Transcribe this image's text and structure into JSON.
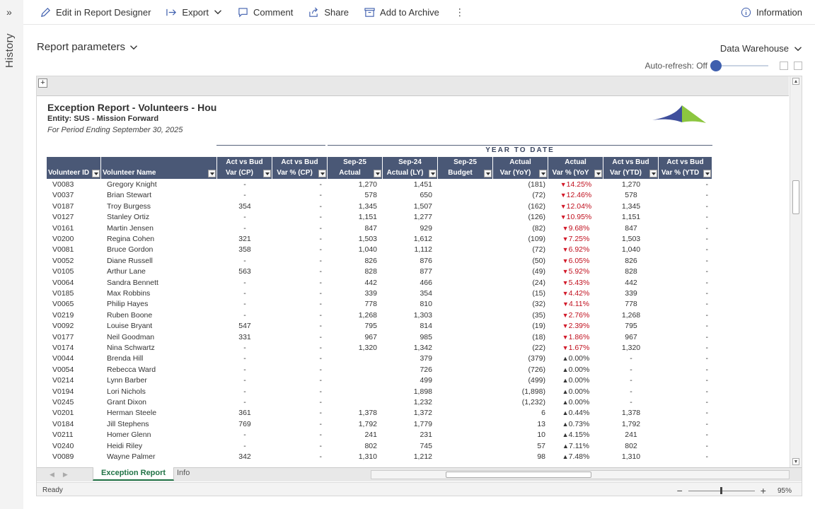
{
  "rail": {
    "chevron": "»",
    "label": "History"
  },
  "toolbar": {
    "edit": "Edit in Report Designer",
    "export": "Export",
    "comment": "Comment",
    "share": "Share",
    "archive": "Add to Archive",
    "more": "⋮",
    "info": "Information"
  },
  "params": {
    "label": "Report parameters"
  },
  "source": {
    "label": "Data Warehouse"
  },
  "refresh": {
    "label": "Auto-refresh: Off"
  },
  "report": {
    "title": "Exception Report - Volunteers - Hou",
    "entity": "Entity: SUS - Mission Forward",
    "period": "For Period Ending September 30, 2025",
    "ytd": "YEAR TO DATE",
    "brand_colors": {
      "blue": "#3f4f9c",
      "green": "#8cc63f"
    }
  },
  "headers": [
    {
      "l1": "",
      "l2": "Volunteer ID"
    },
    {
      "l1": "",
      "l2": "Volunteer Name"
    },
    {
      "l1": "Act vs Bud",
      "l2": "Var (CP)"
    },
    {
      "l1": "Act vs Bud",
      "l2": "Var % (CP)"
    },
    {
      "l1": "Sep-25",
      "l2": "Actual"
    },
    {
      "l1": "Sep-24",
      "l2": "Actual (LY)"
    },
    {
      "l1": "Sep-25",
      "l2": "Budget"
    },
    {
      "l1": "Actual",
      "l2": "Var (YoY)"
    },
    {
      "l1": "Actual",
      "l2": "Var % (YoY"
    },
    {
      "l1": "Act vs Bud",
      "l2": "Var (YTD)"
    },
    {
      "l1": "Act vs Bud",
      "l2": "Var % (YTD"
    }
  ],
  "rows": [
    {
      "id": "V0083",
      "name": "Gregory Knight",
      "var_cp": "-",
      "varp_cp": "-",
      "act": "1,270",
      "ly": "1,451",
      "bud": "",
      "var_yoy": "(181)",
      "dir": "down",
      "pct": "14.25%",
      "var_ytd": "1,270",
      "varp_ytd": "-"
    },
    {
      "id": "V0037",
      "name": "Brian Stewart",
      "var_cp": "-",
      "varp_cp": "-",
      "act": "578",
      "ly": "650",
      "bud": "",
      "var_yoy": "(72)",
      "dir": "down",
      "pct": "12.46%",
      "var_ytd": "578",
      "varp_ytd": "-"
    },
    {
      "id": "V0187",
      "name": "Troy Burgess",
      "var_cp": "354",
      "varp_cp": "-",
      "act": "1,345",
      "ly": "1,507",
      "bud": "",
      "var_yoy": "(162)",
      "dir": "down",
      "pct": "12.04%",
      "var_ytd": "1,345",
      "varp_ytd": "-"
    },
    {
      "id": "V0127",
      "name": "Stanley Ortiz",
      "var_cp": "-",
      "varp_cp": "-",
      "act": "1,151",
      "ly": "1,277",
      "bud": "",
      "var_yoy": "(126)",
      "dir": "down",
      "pct": "10.95%",
      "var_ytd": "1,151",
      "varp_ytd": "-"
    },
    {
      "id": "V0161",
      "name": "Martin Jensen",
      "var_cp": "-",
      "varp_cp": "-",
      "act": "847",
      "ly": "929",
      "bud": "",
      "var_yoy": "(82)",
      "dir": "down",
      "pct": "9.68%",
      "var_ytd": "847",
      "varp_ytd": "-"
    },
    {
      "id": "V0200",
      "name": "Regina Cohen",
      "var_cp": "321",
      "varp_cp": "-",
      "act": "1,503",
      "ly": "1,612",
      "bud": "",
      "var_yoy": "(109)",
      "dir": "down",
      "pct": "7.25%",
      "var_ytd": "1,503",
      "varp_ytd": "-"
    },
    {
      "id": "V0081",
      "name": "Bruce Gordon",
      "var_cp": "358",
      "varp_cp": "-",
      "act": "1,040",
      "ly": "1,112",
      "bud": "",
      "var_yoy": "(72)",
      "dir": "down",
      "pct": "6.92%",
      "var_ytd": "1,040",
      "varp_ytd": "-"
    },
    {
      "id": "V0052",
      "name": "Diane Russell",
      "var_cp": "-",
      "varp_cp": "-",
      "act": "826",
      "ly": "876",
      "bud": "",
      "var_yoy": "(50)",
      "dir": "down",
      "pct": "6.05%",
      "var_ytd": "826",
      "varp_ytd": "-"
    },
    {
      "id": "V0105",
      "name": "Arthur Lane",
      "var_cp": "563",
      "varp_cp": "-",
      "act": "828",
      "ly": "877",
      "bud": "",
      "var_yoy": "(49)",
      "dir": "down",
      "pct": "5.92%",
      "var_ytd": "828",
      "varp_ytd": "-"
    },
    {
      "id": "V0064",
      "name": "Sandra Bennett",
      "var_cp": "-",
      "varp_cp": "-",
      "act": "442",
      "ly": "466",
      "bud": "",
      "var_yoy": "(24)",
      "dir": "down",
      "pct": "5.43%",
      "var_ytd": "442",
      "varp_ytd": "-"
    },
    {
      "id": "V0185",
      "name": "Max Robbins",
      "var_cp": "-",
      "varp_cp": "-",
      "act": "339",
      "ly": "354",
      "bud": "",
      "var_yoy": "(15)",
      "dir": "down",
      "pct": "4.42%",
      "var_ytd": "339",
      "varp_ytd": "-"
    },
    {
      "id": "V0065",
      "name": "Philip Hayes",
      "var_cp": "-",
      "varp_cp": "-",
      "act": "778",
      "ly": "810",
      "bud": "",
      "var_yoy": "(32)",
      "dir": "down",
      "pct": "4.11%",
      "var_ytd": "778",
      "varp_ytd": "-"
    },
    {
      "id": "V0219",
      "name": "Ruben Boone",
      "var_cp": "-",
      "varp_cp": "-",
      "act": "1,268",
      "ly": "1,303",
      "bud": "",
      "var_yoy": "(35)",
      "dir": "down",
      "pct": "2.76%",
      "var_ytd": "1,268",
      "varp_ytd": "-"
    },
    {
      "id": "V0092",
      "name": "Louise Bryant",
      "var_cp": "547",
      "varp_cp": "-",
      "act": "795",
      "ly": "814",
      "bud": "",
      "var_yoy": "(19)",
      "dir": "down",
      "pct": "2.39%",
      "var_ytd": "795",
      "varp_ytd": "-"
    },
    {
      "id": "V0177",
      "name": "Neil Goodman",
      "var_cp": "331",
      "varp_cp": "-",
      "act": "967",
      "ly": "985",
      "bud": "",
      "var_yoy": "(18)",
      "dir": "down",
      "pct": "1.86%",
      "var_ytd": "967",
      "varp_ytd": "-"
    },
    {
      "id": "V0174",
      "name": "Nina Schwartz",
      "var_cp": "-",
      "varp_cp": "-",
      "act": "1,320",
      "ly": "1,342",
      "bud": "",
      "var_yoy": "(22)",
      "dir": "down",
      "pct": "1.67%",
      "var_ytd": "1,320",
      "varp_ytd": "-"
    },
    {
      "id": "V0044",
      "name": "Brenda Hill",
      "var_cp": "-",
      "varp_cp": "-",
      "act": "",
      "ly": "379",
      "bud": "",
      "var_yoy": "(379)",
      "dir": "up",
      "pct": "0.00%",
      "var_ytd": "-",
      "varp_ytd": "-"
    },
    {
      "id": "V0054",
      "name": "Rebecca Ward",
      "var_cp": "-",
      "varp_cp": "-",
      "act": "",
      "ly": "726",
      "bud": "",
      "var_yoy": "(726)",
      "dir": "up",
      "pct": "0.00%",
      "var_ytd": "-",
      "varp_ytd": "-"
    },
    {
      "id": "V0214",
      "name": "Lynn Barber",
      "var_cp": "-",
      "varp_cp": "-",
      "act": "",
      "ly": "499",
      "bud": "",
      "var_yoy": "(499)",
      "dir": "up",
      "pct": "0.00%",
      "var_ytd": "-",
      "varp_ytd": "-"
    },
    {
      "id": "V0194",
      "name": "Lori Nichols",
      "var_cp": "-",
      "varp_cp": "-",
      "act": "",
      "ly": "1,898",
      "bud": "",
      "var_yoy": "(1,898)",
      "dir": "up",
      "pct": "0.00%",
      "var_ytd": "-",
      "varp_ytd": "-"
    },
    {
      "id": "V0245",
      "name": "Grant Dixon",
      "var_cp": "-",
      "varp_cp": "-",
      "act": "",
      "ly": "1,232",
      "bud": "",
      "var_yoy": "(1,232)",
      "dir": "up",
      "pct": "0.00%",
      "var_ytd": "-",
      "varp_ytd": "-"
    },
    {
      "id": "V0201",
      "name": "Herman Steele",
      "var_cp": "361",
      "varp_cp": "-",
      "act": "1,378",
      "ly": "1,372",
      "bud": "",
      "var_yoy": "6",
      "dir": "up",
      "pct": "0.44%",
      "var_ytd": "1,378",
      "varp_ytd": "-"
    },
    {
      "id": "V0184",
      "name": "Jill Stephens",
      "var_cp": "769",
      "varp_cp": "-",
      "act": "1,792",
      "ly": "1,779",
      "bud": "",
      "var_yoy": "13",
      "dir": "up",
      "pct": "0.73%",
      "var_ytd": "1,792",
      "varp_ytd": "-"
    },
    {
      "id": "V0211",
      "name": "Homer Glenn",
      "var_cp": "-",
      "varp_cp": "-",
      "act": "241",
      "ly": "231",
      "bud": "",
      "var_yoy": "10",
      "dir": "up",
      "pct": "4.15%",
      "var_ytd": "241",
      "varp_ytd": "-"
    },
    {
      "id": "V0240",
      "name": "Heidi Riley",
      "var_cp": "-",
      "varp_cp": "-",
      "act": "802",
      "ly": "745",
      "bud": "",
      "var_yoy": "57",
      "dir": "up",
      "pct": "7.11%",
      "var_ytd": "802",
      "varp_ytd": "-"
    },
    {
      "id": "V0089",
      "name": "Wayne Palmer",
      "var_cp": "342",
      "varp_cp": "-",
      "act": "1,310",
      "ly": "1,212",
      "bud": "",
      "var_yoy": "98",
      "dir": "up",
      "pct": "7.48%",
      "var_ytd": "1,310",
      "varp_ytd": "-"
    }
  ],
  "tabs": {
    "active": "Exception Report",
    "other": "Info"
  },
  "status": {
    "ready": "Ready",
    "zoom": "95%",
    "minus": "−",
    "plus": "+"
  }
}
